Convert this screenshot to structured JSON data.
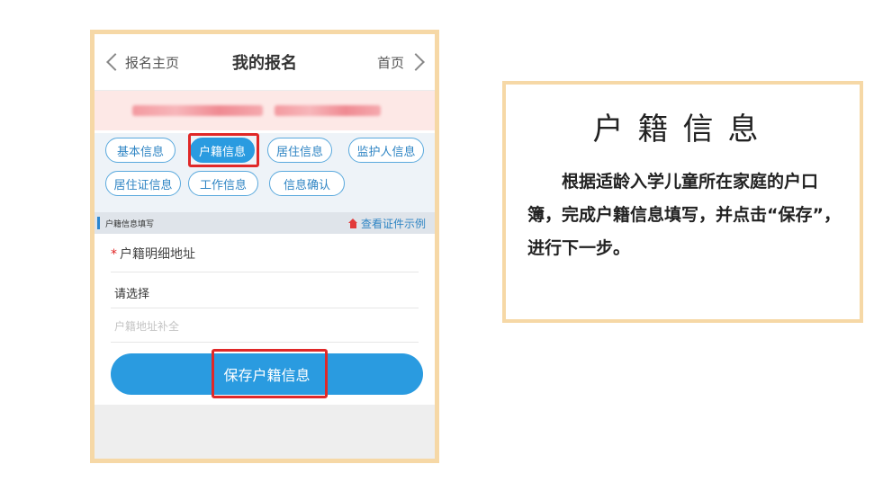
{
  "nav": {
    "back_label": "报名主页",
    "title": "我的报名",
    "home_label": "首页"
  },
  "tabs": [
    {
      "label": "基本信息",
      "active": false
    },
    {
      "label": "户籍信息",
      "active": true
    },
    {
      "label": "居住信息",
      "active": false
    },
    {
      "label": "监护人信息",
      "active": false
    },
    {
      "label": "居住证信息",
      "active": false
    },
    {
      "label": "工作信息",
      "active": false
    },
    {
      "label": "信息确认",
      "active": false
    }
  ],
  "section": {
    "title": "户籍信息填写",
    "sample_link": "查看证件示例"
  },
  "form": {
    "required_mark": "*",
    "address_label": "户籍明细地址",
    "select_value": "请选择",
    "supplement_placeholder": "户籍地址补全"
  },
  "save_button": "保存户籍信息",
  "info_card": {
    "title": "户籍信息",
    "body": "根据适龄入学儿童所在家庭的户口簿，完成户籍信息填写，并点击“保存”，进行下一步。"
  },
  "colors": {
    "frame": "#f6d8a6",
    "accent": "#2a9be0",
    "highlight": "#e02828"
  }
}
